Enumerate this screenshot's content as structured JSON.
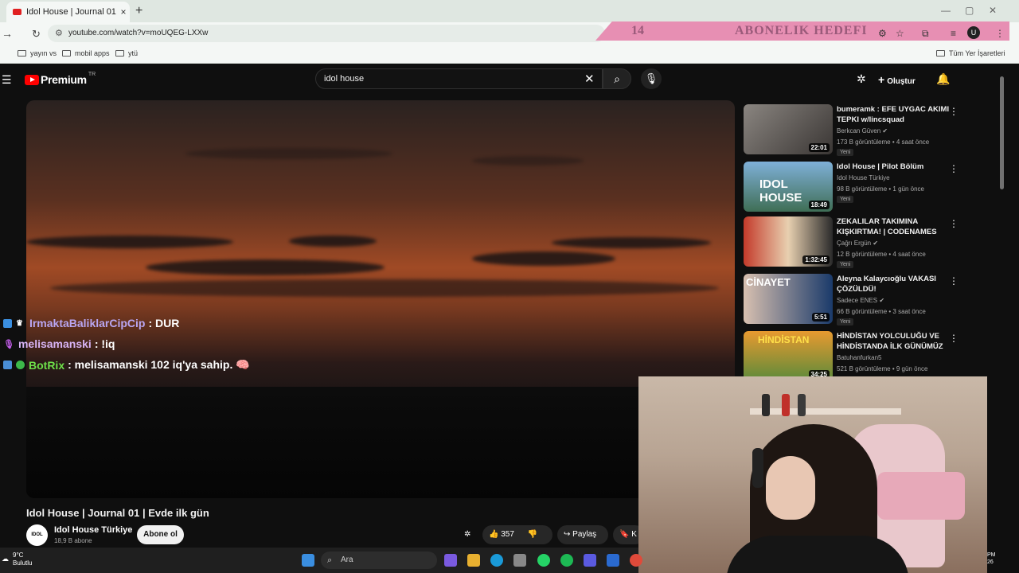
{
  "browser": {
    "tab_title": "Idol House | Journal 01 | Evde ilk g",
    "new_tab": "+",
    "url": "youtube.com/watch?v=moUQEG-LXXw",
    "bookmarks": [
      "yayın vs",
      "mobil apps",
      "ytü"
    ],
    "all_bookmarks": "Tüm Yer İşaretleri"
  },
  "overlay_banner": {
    "number": "14",
    "text": "ABONELIK HEDEFI"
  },
  "youtube": {
    "logo_text": "Premium",
    "logo_region": "TR",
    "search_value": "idol house",
    "create_label": "Oluştur"
  },
  "chat": [
    {
      "user": "IrmaktaBaliklarCipCip",
      "message": ": DUR",
      "color": "#b9a6f2"
    },
    {
      "user": "melisamanski",
      "message": ": !iq",
      "color": "#d8b4f5"
    },
    {
      "user": "BotRix",
      "message": ": melisamanski 102 iq'ya sahip. 🧠",
      "color": "#6ee04a"
    }
  ],
  "video": {
    "title": "Idol House | Journal 01 | Evde ilk gün",
    "channel": "Idol House Türkiye",
    "subscribers": "18,9 B abone",
    "subscribe_label": "Abone ol",
    "likes": "357",
    "share_label": "Paylaş",
    "save_label": "K"
  },
  "recommendations": [
    {
      "title": "bumeramk : EFE UYGAC AKIMI TEPKI w/lincsquad",
      "channel": "Berkcan Güven",
      "verified": true,
      "meta": "173 B görüntüleme • 4 saat önce",
      "badge": "Yeni",
      "duration": "22:01",
      "thumb_color": "#6e6a66"
    },
    {
      "title": "Idol House | Pilot Bölüm",
      "channel": "Idol House Türkiye",
      "verified": false,
      "meta": "98 B görüntüleme • 1 gün önce",
      "badge": "Yeni",
      "duration": "18:49",
      "thumb_color": "#5c7ea1"
    },
    {
      "title": "ZEKALILAR TAKIMINA KIŞKIRTMA! | CODENAMES",
      "channel": "Çağrı Ergün",
      "verified": true,
      "meta": "12 B görüntüleme • 4 saat önce",
      "badge": "Yeni",
      "duration": "1:32:45",
      "thumb_color": "#c83a2a"
    },
    {
      "title": "Aleyna Kalaycıoğlu VAKASI ÇÖZÜLDÜ!",
      "channel": "Sadece ENES",
      "verified": true,
      "meta": "66 B görüntüleme • 3 saat önce",
      "badge": "Yeni",
      "duration": "5:51",
      "thumb_color": "#2a4a7a"
    },
    {
      "title": "HİNDİSTAN YOLCULUĞU VE HİNDİSTANDA İLK GÜNÜMÜZ",
      "channel": "Batuhanfurkan5",
      "verified": false,
      "meta": "521 B görüntüleme • 9 gün önce",
      "badge": "",
      "duration": "34:25",
      "thumb_color": "#d07a20"
    }
  ],
  "taskbar": {
    "temperature": "9°C",
    "weather": "Bulutlu",
    "search_placeholder": "Ara",
    "clock_top": "PM",
    "clock_bottom": "26"
  }
}
